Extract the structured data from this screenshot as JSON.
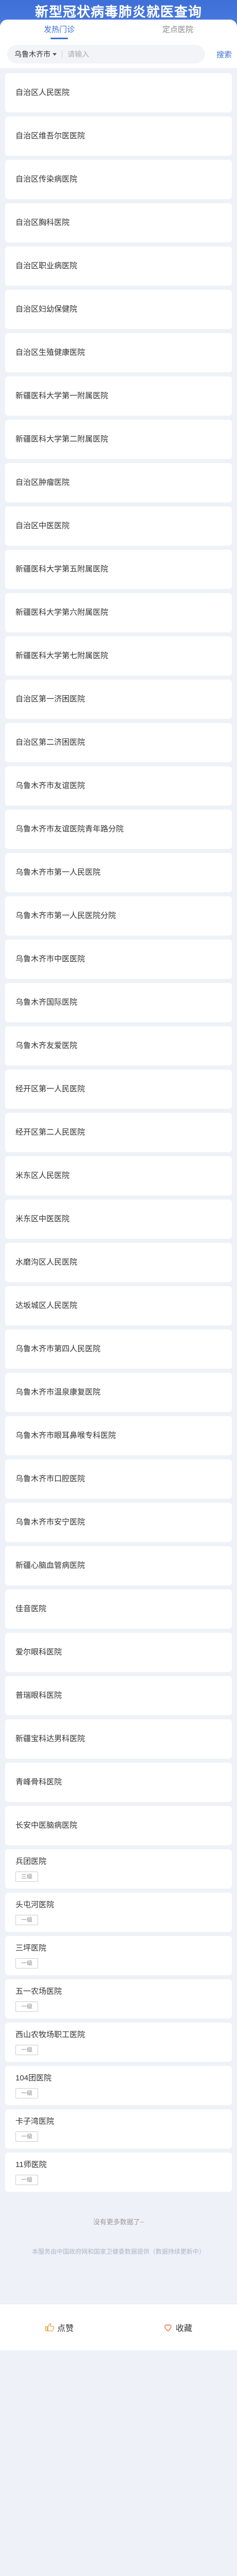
{
  "header": {
    "title": "新型冠状病毒肺炎就医查询"
  },
  "tabs": [
    {
      "label": "发热门诊"
    },
    {
      "label": "定点医院"
    }
  ],
  "search": {
    "city": "乌鲁木齐市",
    "placeholder": "请输入",
    "button_label": "搜索"
  },
  "hospitals": [
    {
      "name": "自治区人民医院"
    },
    {
      "name": "自治区维吾尔医医院"
    },
    {
      "name": "自治区传染病医院"
    },
    {
      "name": "自治区胸科医院"
    },
    {
      "name": "自治区职业病医院"
    },
    {
      "name": "自治区妇幼保健院"
    },
    {
      "name": "自治区生殖健康医院"
    },
    {
      "name": "新疆医科大学第一附属医院"
    },
    {
      "name": "新疆医科大学第二附属医院"
    },
    {
      "name": "自治区肿瘤医院"
    },
    {
      "name": "自治区中医医院"
    },
    {
      "name": "新疆医科大学第五附属医院"
    },
    {
      "name": "新疆医科大学第六附属医院"
    },
    {
      "name": "新疆医科大学第七附属医院"
    },
    {
      "name": "自治区第一济困医院"
    },
    {
      "name": "自治区第二济困医院"
    },
    {
      "name": "乌鲁木齐市友谊医院"
    },
    {
      "name": "乌鲁木齐市友谊医院青年路分院"
    },
    {
      "name": "乌鲁木齐市第一人民医院"
    },
    {
      "name": "乌鲁木齐市第一人民医院分院"
    },
    {
      "name": "乌鲁木齐市中医医院"
    },
    {
      "name": "乌鲁木齐国际医院"
    },
    {
      "name": "乌鲁木齐友爱医院"
    },
    {
      "name": "经开区第一人民医院"
    },
    {
      "name": "经开区第二人民医院"
    },
    {
      "name": "米东区人民医院"
    },
    {
      "name": "米东区中医医院"
    },
    {
      "name": "水磨沟区人民医院"
    },
    {
      "name": "达坂城区人民医院"
    },
    {
      "name": "乌鲁木齐市第四人民医院"
    },
    {
      "name": "乌鲁木齐市温泉康复医院"
    },
    {
      "name": "乌鲁木齐市眼耳鼻喉专科医院"
    },
    {
      "name": "乌鲁木齐市口腔医院"
    },
    {
      "name": "乌鲁木齐市安宁医院"
    },
    {
      "name": "新疆心脑血管病医院"
    },
    {
      "name": "佳音医院"
    },
    {
      "name": "爱尔眼科医院"
    },
    {
      "name": "普瑞眼科医院"
    },
    {
      "name": "新疆宝科达男科医院"
    },
    {
      "name": "青峰骨科医院"
    },
    {
      "name": "长安中医脑病医院"
    },
    {
      "name": "兵团医院",
      "grade": "三级"
    },
    {
      "name": "头屯河医院",
      "grade": "一级"
    },
    {
      "name": "三坪医院",
      "grade": "一级"
    },
    {
      "name": "五一农场医院",
      "grade": "一级"
    },
    {
      "name": "西山农牧场职工医院",
      "grade": "一级"
    },
    {
      "name": "104团医院",
      "grade": "一级"
    },
    {
      "name": "卡子湾医院",
      "grade": "一级"
    },
    {
      "name": "11师医院",
      "grade": "一级"
    }
  ],
  "end_text": "没有更多数据了~",
  "note": "本服务由中国政府网和国家卫健委数据提供（数据持续更新中）",
  "footer": {
    "like_label": "点赞",
    "favorite_label": "收藏"
  },
  "colors": {
    "primary": "#3d6fd8",
    "background": "#eef2f8"
  }
}
